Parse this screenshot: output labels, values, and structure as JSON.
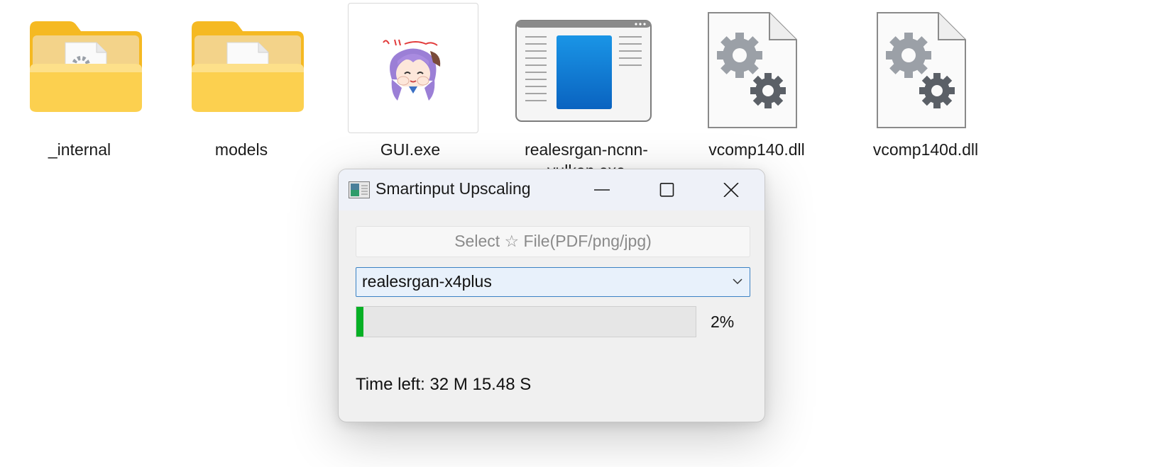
{
  "desktop": {
    "files": [
      {
        "name": "_internal",
        "icon": "folder-with-settings-icon"
      },
      {
        "name": "models",
        "icon": "folder-with-document-icon"
      },
      {
        "name": "GUI.exe",
        "icon": "anime-character-app-icon"
      },
      {
        "name": "realesrgan-ncnn-vulkan.exe",
        "icon": "application-window-icon"
      },
      {
        "name": "vcomp140.dll",
        "icon": "dll-gears-icon"
      },
      {
        "name": "vcomp140d.dll",
        "icon": "dll-gears-icon"
      }
    ]
  },
  "window": {
    "title": "Smartinput Upscaling",
    "select_file_label": "Select ☆ File(PDF/png/jpg)",
    "model": {
      "selected": "realesrgan-x4plus"
    },
    "progress": {
      "value": 2,
      "label": "2%",
      "color": "#06b025"
    },
    "time_left": "Time left: 32 M 15.48 S"
  }
}
